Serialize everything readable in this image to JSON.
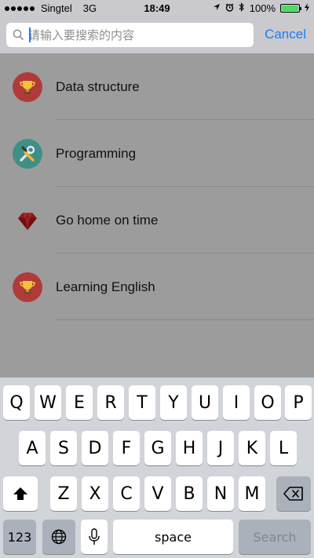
{
  "status_bar": {
    "carrier": "Singtel",
    "network": "3G",
    "time": "18:49",
    "battery": "100%",
    "battery_level": 100,
    "icons": [
      "signal-dots-icon",
      "location-arrow-icon",
      "alarm-clock-icon",
      "bluetooth-icon",
      "battery-icon",
      "charging-bolt-icon"
    ]
  },
  "search": {
    "placeholder": "请输入要搜索的内容",
    "value": "",
    "cancel_label": "Cancel",
    "accent_color": "#1a7ef7"
  },
  "list": {
    "items": [
      {
        "label": "Data structure",
        "icon": "trophy-icon"
      },
      {
        "label": "Programming",
        "icon": "tools-icon"
      },
      {
        "label": "Go home on time",
        "icon": "ruby-gem-icon"
      },
      {
        "label": "Learning English",
        "icon": "trophy-icon"
      }
    ]
  },
  "keyboard": {
    "row1": [
      "Q",
      "W",
      "E",
      "R",
      "T",
      "Y",
      "U",
      "I",
      "O",
      "P"
    ],
    "row2": [
      "A",
      "S",
      "D",
      "F",
      "G",
      "H",
      "J",
      "K",
      "L"
    ],
    "row3": [
      "Z",
      "X",
      "C",
      "V",
      "B",
      "N",
      "M"
    ],
    "numbers_label": "123",
    "space_label": "space",
    "search_label": "Search"
  }
}
